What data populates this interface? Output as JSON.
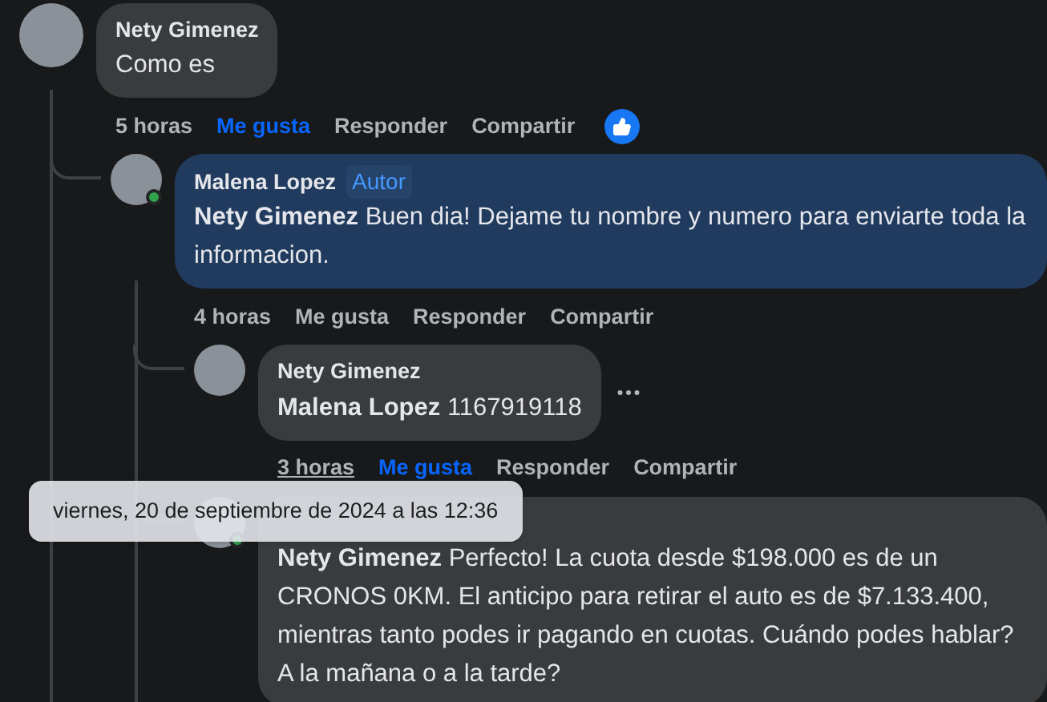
{
  "comments": [
    {
      "author": "Nety Gimenez",
      "text": "Como es",
      "time": "5 horas",
      "time_hovered": false,
      "highlighted": false,
      "liked": true,
      "actions": [
        "Me gusta",
        "Responder",
        "Compartir"
      ],
      "reacted": true,
      "children": [
        {
          "author": "Malena Lopez",
          "badge": "Autor",
          "online": true,
          "text": "**Nety Gimenez** Buen dia! Dejame tu nombre y numero para enviarte toda la informacion.",
          "time": "4 horas",
          "time_hovered": false,
          "highlighted": true,
          "liked": false,
          "actions": [
            "Me gusta",
            "Responder",
            "Compartir"
          ],
          "children": [
            {
              "author": "Nety Gimenez",
              "text": "**Malena Lopez** 1167919118",
              "time": "3 horas",
              "time_hovered": true,
              "highlighted": false,
              "liked": true,
              "more_menu": true,
              "actions": [
                "Me gusta",
                "Responder",
                "Compartir"
              ]
            },
            {
              "online": true,
              "text": "**Nety Gimenez** Perfecto! La cuota desde $198.000 es de un CRONOS 0KM. El anticipo para retirar el auto es de $7.133.400, mientras tanto podes ir pagando en cuotas. Cuándo podes hablar? A la mañana o a la tarde?",
              "highlighted": false
            }
          ]
        }
      ]
    }
  ],
  "tooltip": {
    "text": "viernes, 20 de septiembre de 2024 a las 12:36"
  }
}
